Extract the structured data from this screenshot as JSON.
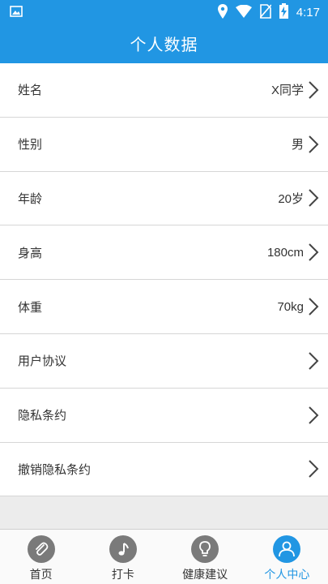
{
  "status_bar": {
    "time": "4:17"
  },
  "header": {
    "title": "个人数据"
  },
  "rows": [
    {
      "label": "姓名",
      "value": "X同学"
    },
    {
      "label": "性别",
      "value": "男"
    },
    {
      "label": "年龄",
      "value": "20岁"
    },
    {
      "label": "身高",
      "value": "180cm"
    },
    {
      "label": "体重",
      "value": "70kg"
    },
    {
      "label": "用户协议",
      "value": ""
    },
    {
      "label": "隐私条约",
      "value": ""
    },
    {
      "label": "撤销隐私条约",
      "value": ""
    }
  ],
  "tabs": [
    {
      "label": "首页",
      "icon": "paperclip-icon"
    },
    {
      "label": "打卡",
      "icon": "music-note-icon"
    },
    {
      "label": "健康建议",
      "icon": "lightbulb-icon"
    },
    {
      "label": "个人中心",
      "icon": "person-icon",
      "active": true
    }
  ],
  "colors": {
    "primary": "#2196e3",
    "inactive_icon": "#7a7a7a"
  }
}
